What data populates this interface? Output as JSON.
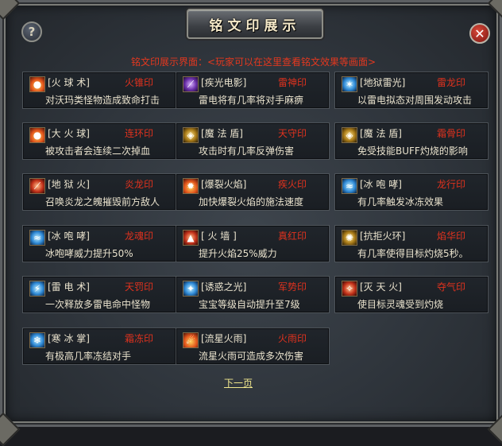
{
  "window": {
    "title": "铭文印展示",
    "subtitle": "铭文印展示界面：<玩家可以在这里查看铭文效果等画面>",
    "help_label": "?",
    "close_label": "✕"
  },
  "items": [
    {
      "name": "[火  球  术]",
      "seal": "火锥印",
      "desc": "对沃玛类怪物造成致命打击",
      "icon": "fire-orb-icon",
      "icon_class": "ic-fire",
      "glyph": "●"
    },
    {
      "name": "[疾光电影]",
      "seal": "雷神印",
      "desc": "雷电将有几率将对手麻痹",
      "icon": "lightning-bolt-icon",
      "icon_class": "ic-purple",
      "glyph": "⟋"
    },
    {
      "name": "[地狱雷光]",
      "seal": "雷龙印",
      "desc": "以雷电拟态对周围发动攻击",
      "icon": "thunder-burst-icon",
      "icon_class": "ic-blue",
      "glyph": "✶"
    },
    {
      "name": "[大  火  球]",
      "seal": "连环印",
      "desc": "被攻击者会连续二次掉血",
      "icon": "big-fireball-icon",
      "icon_class": "ic-fire",
      "glyph": "●"
    },
    {
      "name": "[魔  法  盾]",
      "seal": "天守印",
      "desc": "攻击时有几率反弹伤害",
      "icon": "magic-shield-icon",
      "icon_class": "ic-gold",
      "glyph": "◈"
    },
    {
      "name": "[魔  法  盾]",
      "seal": "霜骨印",
      "desc": "免受技能BUFF灼烧的影响",
      "icon": "magic-shield-icon",
      "icon_class": "ic-gold",
      "glyph": "◈"
    },
    {
      "name": "[地  狱  火]",
      "seal": "炎龙印",
      "desc": "召唤炎龙之魄摧毁前方敌人",
      "icon": "hellfire-icon",
      "icon_class": "ic-red",
      "glyph": "⟋"
    },
    {
      "name": "[爆裂火焰]",
      "seal": "疾火印",
      "desc": "加快爆裂火焰的施法速度",
      "icon": "burst-flame-icon",
      "icon_class": "ic-fire",
      "glyph": "✹"
    },
    {
      "name": "[冰  咆  哮]",
      "seal": "龙行印",
      "desc": "有几率触发冰冻效果",
      "icon": "ice-roar-icon",
      "icon_class": "ic-blue",
      "glyph": "≈"
    },
    {
      "name": "[冰  咆  哮]",
      "seal": "龙魂印",
      "desc": "冰咆哮威力提升50%",
      "icon": "ice-roar-icon",
      "icon_class": "ic-blue",
      "glyph": "≈"
    },
    {
      "name": "[  火    墙  ]",
      "seal": "真红印",
      "desc": "提升火焰25%威力",
      "icon": "fire-wall-icon",
      "icon_class": "ic-red",
      "glyph": "▲"
    },
    {
      "name": "[抗拒火环]",
      "seal": "焰华印",
      "desc": "有几率使得目标灼烧5秒。",
      "icon": "fire-ring-icon",
      "icon_class": "ic-gold",
      "glyph": "✺"
    },
    {
      "name": "[雷  电  术]",
      "seal": "天罚印",
      "desc": "一次释放多雷电命中怪物",
      "icon": "lightning-strike-icon",
      "icon_class": "ic-blue",
      "glyph": "⚡"
    },
    {
      "name": "[诱惑之光]",
      "seal": "军势印",
      "desc": "宝宝等级自动提升至7级",
      "icon": "charm-light-icon",
      "icon_class": "ic-blue",
      "glyph": "✦"
    },
    {
      "name": "[灭  天  火]",
      "seal": "夺气印",
      "desc": "使目标灵魂受到灼烧",
      "icon": "sky-fire-icon",
      "icon_class": "ic-red",
      "glyph": "✧"
    },
    {
      "name": "[寒  冰  掌]",
      "seal": "霜冻印",
      "desc": "有极高几率冻结对手",
      "icon": "frost-palm-icon",
      "icon_class": "ic-blue",
      "glyph": "❄"
    },
    {
      "name": "[流星火雨]",
      "seal": "火雨印",
      "desc": "流星火雨可造成多次伤害",
      "icon": "meteor-rain-icon",
      "icon_class": "ic-fire",
      "glyph": "☄"
    }
  ],
  "pager": {
    "next_label": "下一页"
  },
  "colors": {
    "seal_red": "#e0321e",
    "text_cream": "#e9e2cd",
    "link_yellow": "#f0e68c"
  }
}
